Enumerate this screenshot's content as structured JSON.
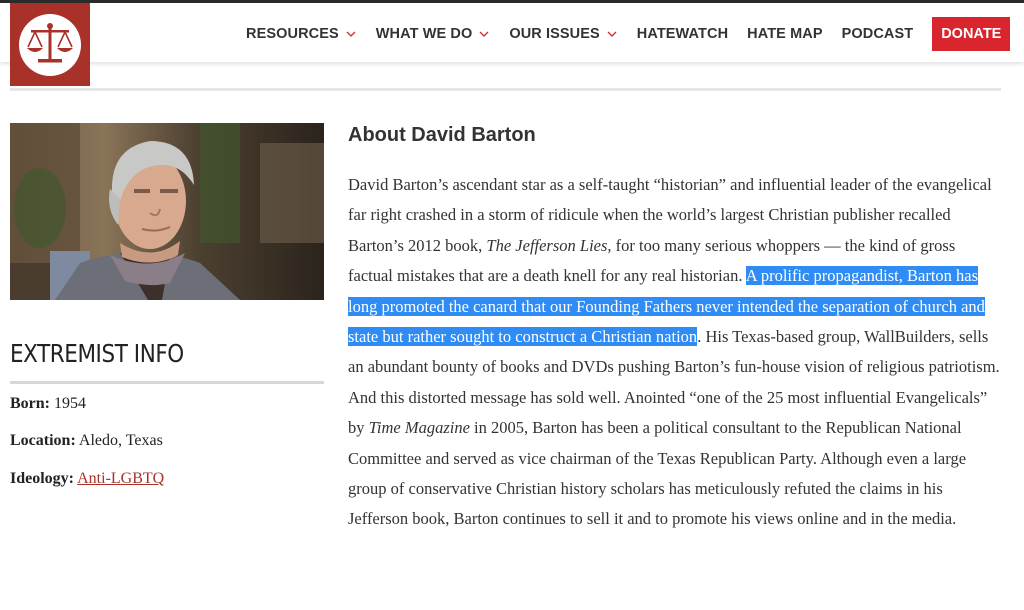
{
  "header": {
    "nav": [
      {
        "label": "RESOURCES",
        "has_dropdown": true
      },
      {
        "label": "WHAT WE DO",
        "has_dropdown": true
      },
      {
        "label": "OUR ISSUES",
        "has_dropdown": true
      },
      {
        "label": "HATEWATCH",
        "has_dropdown": false
      },
      {
        "label": "HATE MAP",
        "has_dropdown": false
      },
      {
        "label": "PODCAST",
        "has_dropdown": false
      }
    ],
    "donate_label": "DONATE",
    "search_icon": "search-icon",
    "brand_color": "#a8322a",
    "donate_color": "#d9262e"
  },
  "sidebar": {
    "title": "EXTREMIST INFO",
    "born_label": "Born:",
    "born_value": "1954",
    "location_label": "Location:",
    "location_value": "Aledo, Texas",
    "ideology_label": "Ideology:",
    "ideology_value": "Anti-LGBTQ"
  },
  "main": {
    "title": "About David Barton",
    "text_1": "David Barton’s ascendant star as a self-taught “historian” and influential leader of the evangelical far right crashed in a storm of ridicule when the world’s largest Christian publisher recalled Barton’s 2012 book, ",
    "book_title": "The Jefferson Lies,",
    "text_2": " for too many serious whoppers — the kind of gross factual mistakes that are a death knell for any real historian. ",
    "highlighted": "A prolific propagandist, Barton has long promoted the canard that our Founding Fathers never intended the separation of church and state but rather sought to construct a Christian nation",
    "text_3": ". His Texas-based group, WallBuilders, sells an abundant bounty of books and DVDs pushing Barton’s fun-house vision of religious patriotism. And this distorted message has sold well. Anointed “one of the 25 most influential Evangelicals” by ",
    "magazine": "Time Magazine",
    "text_4": " in 2005, Barton has been a political consultant to the Republican National Committee and served as vice chairman of the Texas Republican Party. Although even a large group of conservative Christian history scholars has meticulously refuted the claims in his Jefferson book, Barton continues to sell it and to promote his views online and in the media.",
    "highlight_color": "#2f8cf5"
  }
}
